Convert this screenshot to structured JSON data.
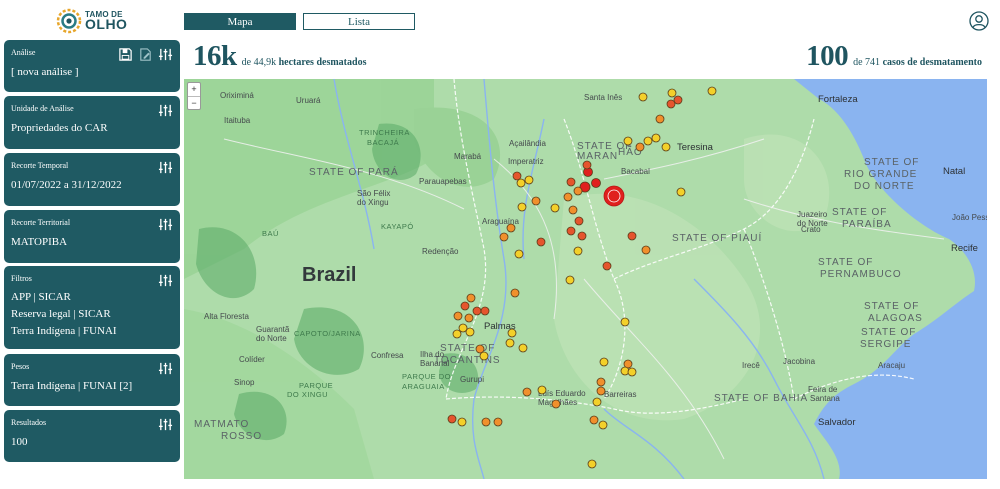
{
  "brand": {
    "line1": "TAMO DE",
    "line2": "OLHO"
  },
  "tabs": {
    "map": "Mapa",
    "list": "Lista"
  },
  "stats": {
    "area_value": "16k",
    "area_of": "de 44,9k",
    "area_unit": "hectares desmatados",
    "cases_value": "100",
    "cases_of": "de 741",
    "cases_unit": "casos de desmatamento"
  },
  "sidebar": {
    "analysis": {
      "title": "Análise",
      "value": "[ nova análise ]"
    },
    "unit": {
      "title": "Unidade de Análise",
      "value": "Propriedades do CAR"
    },
    "period": {
      "title": "Recorte Temporal",
      "value": "01/07/2022 a 31/12/2022"
    },
    "territory": {
      "title": "Recorte Territorial",
      "value": "MATOPIBA"
    },
    "filters": {
      "title": "Filtros",
      "items": [
        "APP | SICAR",
        "Reserva legal | SICAR",
        "Terra Indígena | FUNAI"
      ]
    },
    "weights": {
      "title": "Pesos",
      "value": "Terra Indígena | FUNAI [2]"
    },
    "results": {
      "title": "Resultados",
      "value": "100"
    }
  },
  "map": {
    "zoom_in": "+",
    "zoom_out": "−",
    "country": "Brazil",
    "states": [
      "STATE OF PARÁ",
      "STATE OF MARAN",
      "HÃO",
      "STATE OF PIAUÍ",
      "STATE OF TOCANTINS",
      "STATE OF BAHIA",
      "STATE OF MATO GROSSO",
      "STATE OF RIO GRANDE DO NORTE",
      "STATE OF PARAÍBA",
      "STATE OF PERNAMBUCO",
      "STATE OF ALAGOAS",
      "STATE OF SERGIPE"
    ],
    "capitals": [
      "Fortaleza",
      "Natal",
      "Recife",
      "Salvador",
      "Teresina",
      "Palmas",
      "João Pessoa"
    ],
    "cities": [
      "Santa Inês",
      "Bacabal",
      "Marabá",
      "Açailândia",
      "Imperatriz",
      "Parauapebas",
      "Araguaína",
      "Redenção",
      "Gurupi",
      "Ilha do Bananal",
      "Confresa",
      "Colíder",
      "Sinop",
      "Alta Floresta",
      "Guarantã do Norte",
      "Barreiras",
      "Luís Eduardo Magalhães",
      "Juazeiro do Norte",
      "Irecê",
      "Jacobina",
      "Feira de Santana",
      "Aracaju",
      "Crato",
      "Oriximiná",
      "Itaituba",
      "Uruará",
      "São Félix do Xingu"
    ],
    "areas": [
      "TRINCHEIRA BACAJÁ",
      "KAYAPÓ",
      "BAÚ",
      "CAPOTO/JARINA",
      "PARQUE DO XINGU",
      "PARQUE DO ARAGUAIA",
      "MATMATO ROSSO"
    ],
    "legend_colors": {
      "high": "#e0201e",
      "mid_high": "#e5552d",
      "mid": "#f0902c",
      "low": "#f3d02a"
    }
  }
}
